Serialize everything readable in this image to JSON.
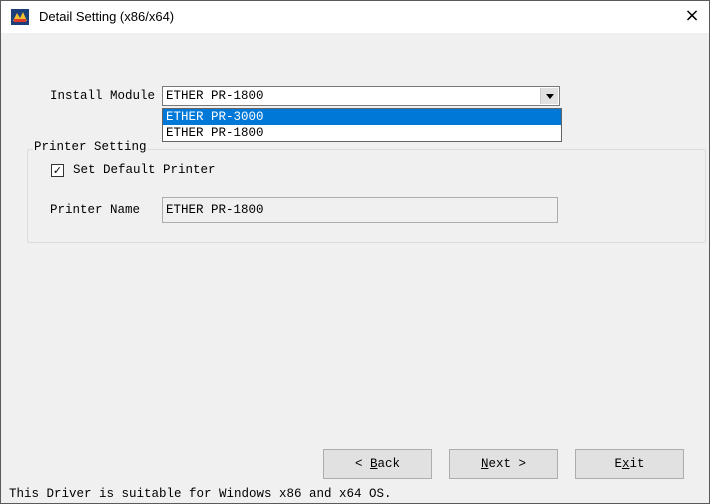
{
  "window": {
    "title": "Detail Setting (x86/x64)",
    "close_glyph": "×"
  },
  "install_module": {
    "label": "Install Module",
    "selected_value": "ETHER PR-1800",
    "options": [
      {
        "label": "ETHER PR-3000",
        "highlighted": true
      },
      {
        "label": "ETHER PR-1800",
        "highlighted": false
      }
    ]
  },
  "printer_setting": {
    "group_title": "Printer Setting",
    "set_default": {
      "label": "Set Default Printer",
      "checked": true
    },
    "printer_name": {
      "label": "Printer Name",
      "value": "ETHER PR-1800"
    }
  },
  "buttons": {
    "back": {
      "accel": "B",
      "rest": "ack"
    },
    "next": {
      "accel": "N",
      "rest": "ext"
    },
    "exit": {
      "pre": "E",
      "accel": "x",
      "rest": "it"
    }
  },
  "status_text": "This Driver is suitable for Windows x86 and x64 OS.",
  "colors": {
    "selection": "#0078d7",
    "window_bg": "#f0f0f0"
  }
}
